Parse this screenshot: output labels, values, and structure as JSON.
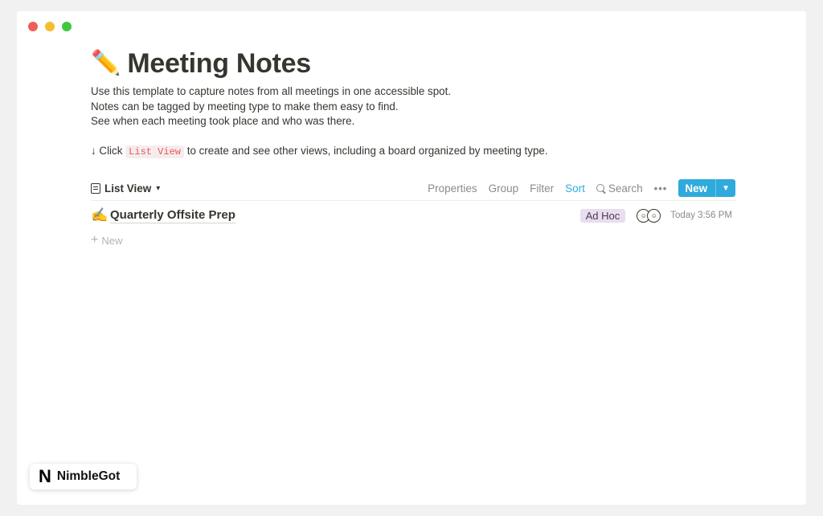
{
  "page": {
    "title_emoji": "✏️",
    "title": "Meeting Notes",
    "description": [
      "Use this template to capture notes from all meetings in one accessible spot.",
      "Notes can be tagged by meeting type to make them easy to find.",
      "See when each meeting took place and who was there."
    ],
    "click_line": {
      "prefix": "↓ Click",
      "code": "List View",
      "suffix": "to create and see other views, including a board organized by meeting type."
    }
  },
  "toolbar": {
    "view_label": "List View",
    "properties": "Properties",
    "group": "Group",
    "filter": "Filter",
    "sort": "Sort",
    "search": "Search",
    "more": "•••",
    "new_label": "New",
    "accent_color": "#2eaadc"
  },
  "rows": [
    {
      "emoji": "✍️",
      "title": "Quarterly Offsite Prep",
      "tag": "Ad Hoc",
      "tag_color": "#e8deee",
      "time": "Today 3:56 PM"
    }
  ],
  "new_row_label": "New",
  "badge": {
    "logo": "N",
    "text": "NimbleGot"
  }
}
